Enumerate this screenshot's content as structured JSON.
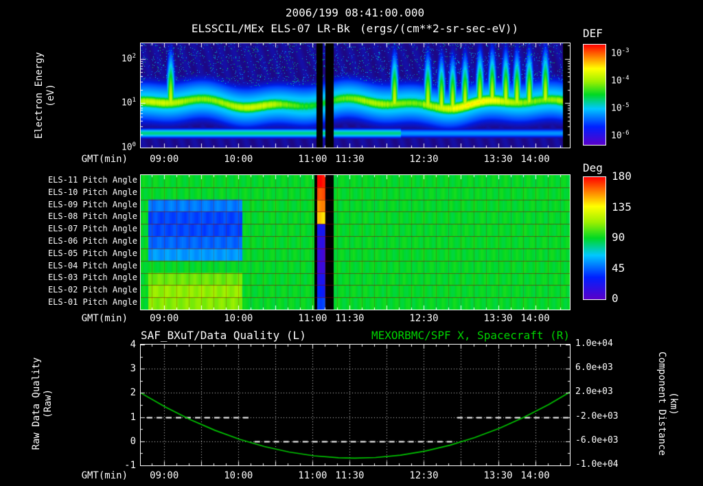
{
  "header": {
    "datetime": "2006/199 08:41:00.000",
    "instrument": "ELSSCIL/MEx ELS-07 LR-Bk",
    "units": "(ergs/(cm**2-sr-sec-eV))"
  },
  "colors": {
    "background": "#000000",
    "text": "#ffffff",
    "series_green": "#00c800",
    "title_right_green": "#00d400"
  },
  "colormap_stops": [
    {
      "f": 0.0,
      "c": "#5a00c8"
    },
    {
      "f": 0.18,
      "c": "#0020ff"
    },
    {
      "f": 0.36,
      "c": "#00c8ff"
    },
    {
      "f": 0.5,
      "c": "#00d824"
    },
    {
      "f": 0.63,
      "c": "#9cf000"
    },
    {
      "f": 0.76,
      "c": "#ffff00"
    },
    {
      "f": 0.88,
      "c": "#ff8000"
    },
    {
      "f": 1.0,
      "c": "#ff0000"
    }
  ],
  "time_axis": {
    "label": "GMT(min)",
    "start_time": "08:41:00",
    "end_min": 347,
    "minor_step_min": 10,
    "major_step_min": 30,
    "first_minor_t": 9,
    "first_major_t": 19,
    "ticks": [
      {
        "label": "09:00",
        "t": 19
      },
      {
        "label": "10:00",
        "t": 79
      },
      {
        "label": "11:00",
        "t": 139
      },
      {
        "label": "11:30",
        "t": 169
      },
      {
        "label": "12:30",
        "t": 229
      },
      {
        "label": "13:30",
        "t": 289
      },
      {
        "label": "14:00",
        "t": 319
      }
    ]
  },
  "chart_data": [
    {
      "type": "heatmap",
      "title": "ELSSCIL/MEx ELS-07 LR-Bk",
      "ylabel": "Electron Energy (eV)",
      "ylabel_l1": "Electron Energy",
      "ylabel_l2": "(eV)",
      "y_scale": "log",
      "ylim_log_top": 2.35,
      "y_ticks": [
        {
          "base": "10",
          "exp": "2",
          "log": 2
        },
        {
          "base": "10",
          "exp": "1",
          "log": 1
        },
        {
          "base": "10",
          "exp": "0",
          "log": 0
        }
      ],
      "colorbar": {
        "label": "DEF",
        "ticks": [
          {
            "base": "10",
            "exp": "-3",
            "f": 0.09
          },
          {
            "base": "10",
            "exp": "-4",
            "f": 0.36
          },
          {
            "base": "10",
            "exp": "-5",
            "f": 0.64
          },
          {
            "base": "10",
            "exp": "-6",
            "f": 0.91
          }
        ]
      },
      "features": {
        "main_band_center_logE": 1.0,
        "main_band_peak_value": 0.62,
        "band_width_log": 0.17,
        "halo_value": 0.4,
        "halo_width_log": 0.5,
        "low_band_center_logE": 0.33,
        "low_band_value": 0.44,
        "background_value": 0.1,
        "gap_intervals_min": [
          [
            142,
            147
          ],
          [
            149,
            156
          ],
          [
            341,
            347
          ]
        ],
        "burst_times_min": [
          24,
          205,
          232,
          243,
          252,
          262,
          274,
          284,
          295,
          304,
          314,
          327
        ],
        "enhanced_after_min": 228
      }
    },
    {
      "type": "heatmap",
      "rows": [
        "ELS-11 Pitch Angle",
        "ELS-10 Pitch Angle",
        "ELS-09 Pitch Angle",
        "ELS-08 Pitch Angle",
        "ELS-07 Pitch Angle",
        "ELS-06 Pitch Angle",
        "ELS-05 Pitch Angle",
        "ELS-04 Pitch Angle",
        "ELS-03 Pitch Angle",
        "ELS-02 Pitch Angle",
        "ELS-01 Pitch Angle"
      ],
      "value_units": "deg",
      "vmin": 0,
      "vmax": 180,
      "colorbar": {
        "label": "Deg",
        "ticks": [
          180,
          135,
          90,
          45,
          0
        ]
      },
      "baseline_deg": 90,
      "left_region": {
        "t_range": [
          6,
          82
        ],
        "row_values_deg": [
          90,
          90,
          50,
          40,
          40,
          46,
          56,
          90,
          106,
          112,
          110
        ]
      },
      "event_stripe": {
        "t_range": [
          142.5,
          149
        ],
        "row_values_deg": [
          178,
          168,
          156,
          144,
          26,
          14,
          10,
          12,
          20,
          30,
          40
        ]
      },
      "gaps_min": [
        [
          140,
          142.5
        ],
        [
          149,
          156
        ]
      ]
    },
    {
      "type": "line",
      "title_left": "SAF_BXuT/Data Quality (L)",
      "title_right": "MEXORBMC/SPF X, Spacecraft (R)",
      "ylabel_left": "Raw Data Quality (Raw)",
      "ylabel_left_l1": "Raw Data Quality",
      "ylabel_left_l2": "(Raw)",
      "ylabel_right": "Component Distance (km)",
      "ylabel_right_l1": "Component Distance",
      "ylabel_right_l2": "(km)",
      "ylim_left": [
        -1,
        4
      ],
      "yticks_left": [
        {
          "label": "4",
          "v": 4
        },
        {
          "label": "3",
          "v": 3
        },
        {
          "label": "2",
          "v": 2
        },
        {
          "label": "1",
          "v": 1
        },
        {
          "label": "0",
          "v": 0
        },
        {
          "label": "-1",
          "v": -1
        }
      ],
      "ylim_right": [
        -10000,
        10000
      ],
      "yticks_right": [
        {
          "label": "1.0e+04",
          "v": 10000
        },
        {
          "label": "6.0e+03",
          "v": 6000
        },
        {
          "label": "2.0e+03",
          "v": 2000
        },
        {
          "label": "-2.0e+03",
          "v": -2000
        },
        {
          "label": "-6.0e+03",
          "v": -6000
        },
        {
          "label": "-1.0e+04",
          "v": -10000
        }
      ],
      "grid": "dotted",
      "series": [
        {
          "name": "SAF_BXuT/Data Quality",
          "axis": "left",
          "style": "dashed",
          "color": "#ffffff",
          "segments": [
            {
              "t": [
                5,
                88
              ],
              "value": 1
            },
            {
              "t": [
                92,
                253
              ],
              "value": 0
            },
            {
              "t": [
                256,
                347
              ],
              "value": 1
            }
          ]
        },
        {
          "name": "MEXORBMC/SPF X Spacecraft",
          "axis": "right",
          "style": "solid",
          "color": "#00c800",
          "points_t_min": [
            0,
            20,
            40,
            60,
            80,
            100,
            120,
            140,
            160,
            173,
            190,
            210,
            230,
            250,
            270,
            290,
            310,
            330,
            347
          ],
          "points_km": [
            2004,
            -349,
            -2414,
            -4190,
            -5678,
            -6876,
            -7786,
            -8407,
            -8739,
            -8800,
            -8696,
            -8306,
            -7627,
            -6660,
            -5403,
            -3858,
            -2024,
            98,
            2130
          ]
        }
      ]
    }
  ]
}
